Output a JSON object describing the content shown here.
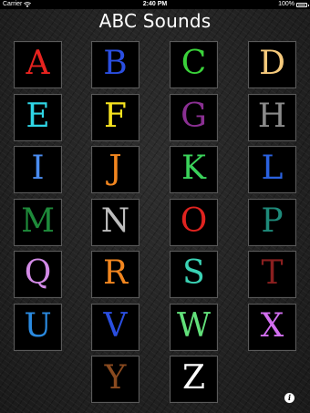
{
  "status_bar": {
    "carrier": "Carrier",
    "time": "2:40 PM",
    "battery": "100%"
  },
  "app": {
    "title": "ABC Sounds"
  },
  "letters": [
    {
      "label": "A",
      "color": "#e8231f"
    },
    {
      "label": "B",
      "color": "#2a4ee0"
    },
    {
      "label": "C",
      "color": "#3ad23a"
    },
    {
      "label": "D",
      "color": "#f5c97b"
    },
    {
      "label": "E",
      "color": "#2fd6e6"
    },
    {
      "label": "F",
      "color": "#f7e31f"
    },
    {
      "label": "G",
      "color": "#8a2f92"
    },
    {
      "label": "H",
      "color": "#8a8a8a"
    },
    {
      "label": "I",
      "color": "#4a8cf0"
    },
    {
      "label": "J",
      "color": "#f2861f"
    },
    {
      "label": "K",
      "color": "#3ad25a"
    },
    {
      "label": "L",
      "color": "#2a62e0"
    },
    {
      "label": "M",
      "color": "#1e8a3a"
    },
    {
      "label": "N",
      "color": "#bdbdbd"
    },
    {
      "label": "O",
      "color": "#e0231f"
    },
    {
      "label": "P",
      "color": "#1e8a7a"
    },
    {
      "label": "Q",
      "color": "#d28ae6"
    },
    {
      "label": "R",
      "color": "#f2861f"
    },
    {
      "label": "S",
      "color": "#3ad2b4"
    },
    {
      "label": "T",
      "color": "#8a1f1f"
    },
    {
      "label": "U",
      "color": "#2a8ae0"
    },
    {
      "label": "V",
      "color": "#2a4ee0"
    },
    {
      "label": "W",
      "color": "#62e07a"
    },
    {
      "label": "X",
      "color": "#d26ef0"
    },
    {
      "label": "Y",
      "color": "#8a4a1f"
    },
    {
      "label": "Z",
      "color": "#ffffff"
    }
  ],
  "info_button": {
    "icon": "info-icon",
    "label": "i"
  }
}
